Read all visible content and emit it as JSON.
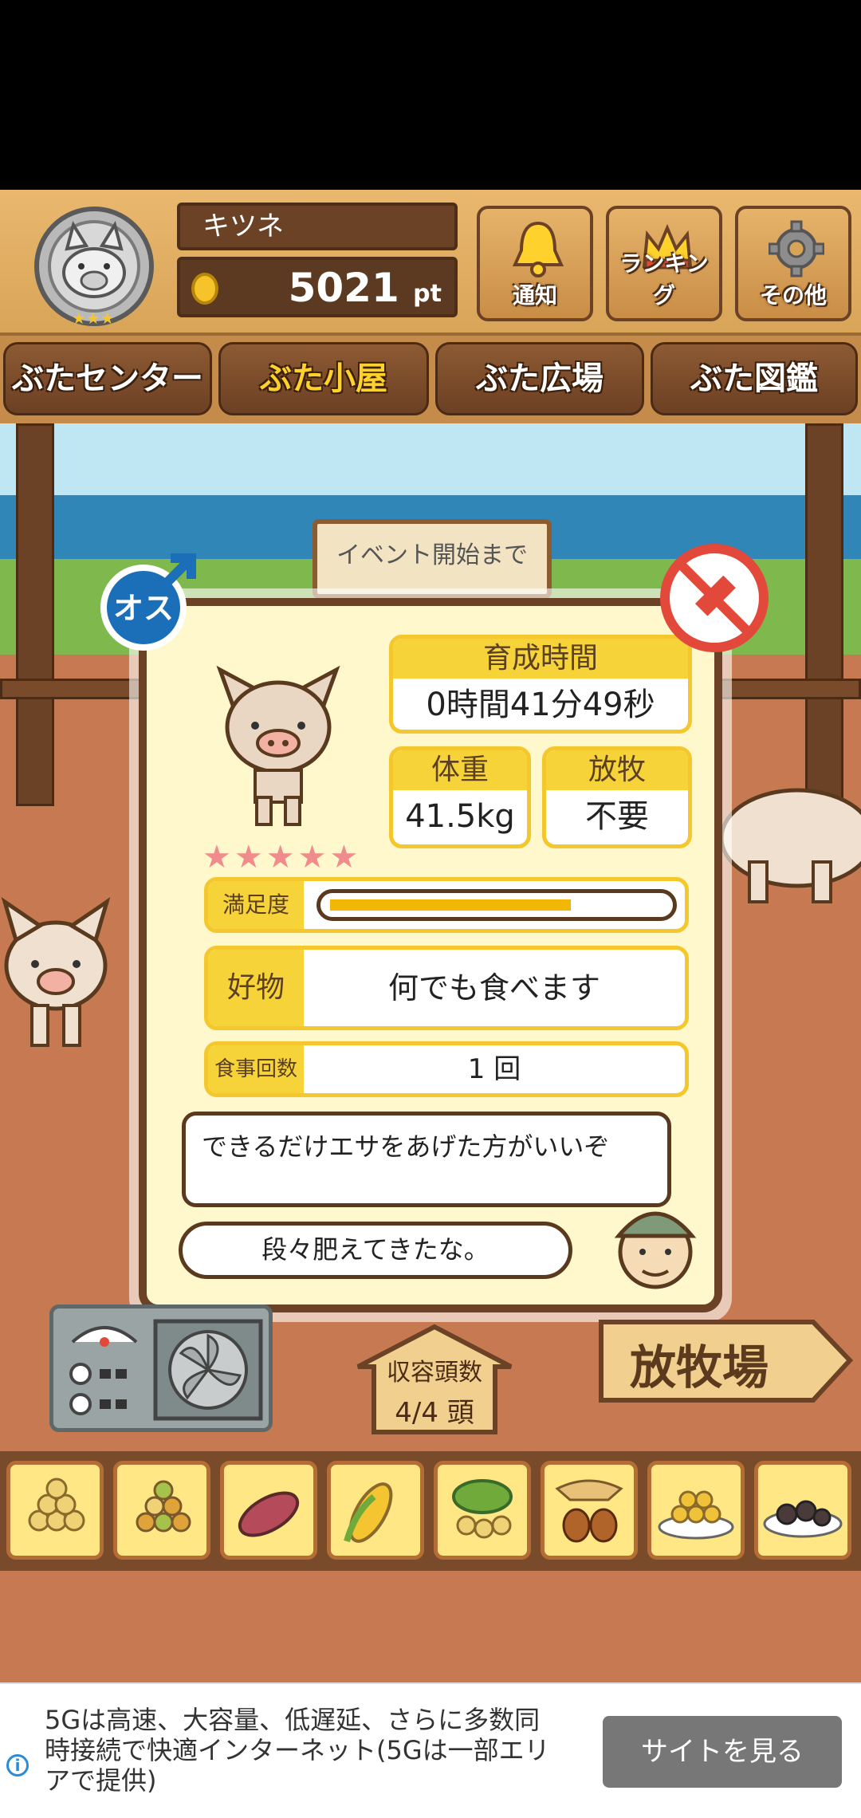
{
  "header": {
    "player_name": "キツネ",
    "points": "5021",
    "points_unit": "pt",
    "buttons": {
      "notify": "通知",
      "ranking": "ランキング",
      "other": "その他"
    }
  },
  "tabs": [
    {
      "label": "ぶたセンター",
      "active": false
    },
    {
      "label": "ぶた小屋",
      "active": true
    },
    {
      "label": "ぶた広場",
      "active": false
    },
    {
      "label": "ぶた図鑑",
      "active": false
    }
  ],
  "scene": {
    "event_sign": "イベント開始まで"
  },
  "pig_card": {
    "sex_label": "オス",
    "raise_time_label": "育成時間",
    "raise_time_value": "0時間41分49秒",
    "weight_label": "体重",
    "weight_value": "41.5kg",
    "grazing_label": "放牧",
    "grazing_value": "不要",
    "stars": "★★★★★",
    "satisfaction_label": "満足度",
    "satisfaction_level": 0.72,
    "favorite_label": "好物",
    "favorite_value": "何でも食べます",
    "meals_label": "食事回数",
    "meals_value": "1 回",
    "advice_1": "できるだけエサをあげた方がいいぞ",
    "advice_2": "段々肥えてきたな。"
  },
  "bottom": {
    "capacity_label": "収容頭数",
    "capacity_value": "4/4 頭",
    "pasture_label": "放牧場"
  },
  "ad": {
    "text": "5Gは高速、大容量、低遅延、さらに多数同時接続で快適インターネット(5Gは一部エリアで提供)",
    "button": "サイトを見る"
  },
  "colors": {
    "wood": "#d8a458",
    "dark_wood": "#6b4226",
    "card_bg": "#fff8cc",
    "accent_yellow": "#f7d33a",
    "satisfaction_bar": "#f2b705"
  }
}
